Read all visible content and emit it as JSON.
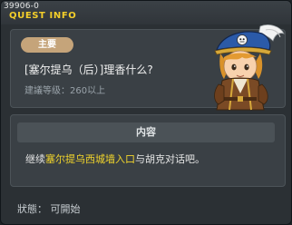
{
  "window": {
    "quest_id": "39906-0",
    "title": "QUEST INFO"
  },
  "summary": {
    "badge": "主要",
    "quest_name": "[塞尔提乌（后）]理香什么?",
    "level_req": "建議等级：260以上"
  },
  "content": {
    "title": "内容",
    "desc_prefix": "继续",
    "desc_highlight": "塞尔提乌西城墙入口",
    "desc_suffix": "与胡克对话吧。"
  },
  "status": "狀態： 可開始",
  "icons": {
    "npc": "npc-pirate-portrait"
  }
}
